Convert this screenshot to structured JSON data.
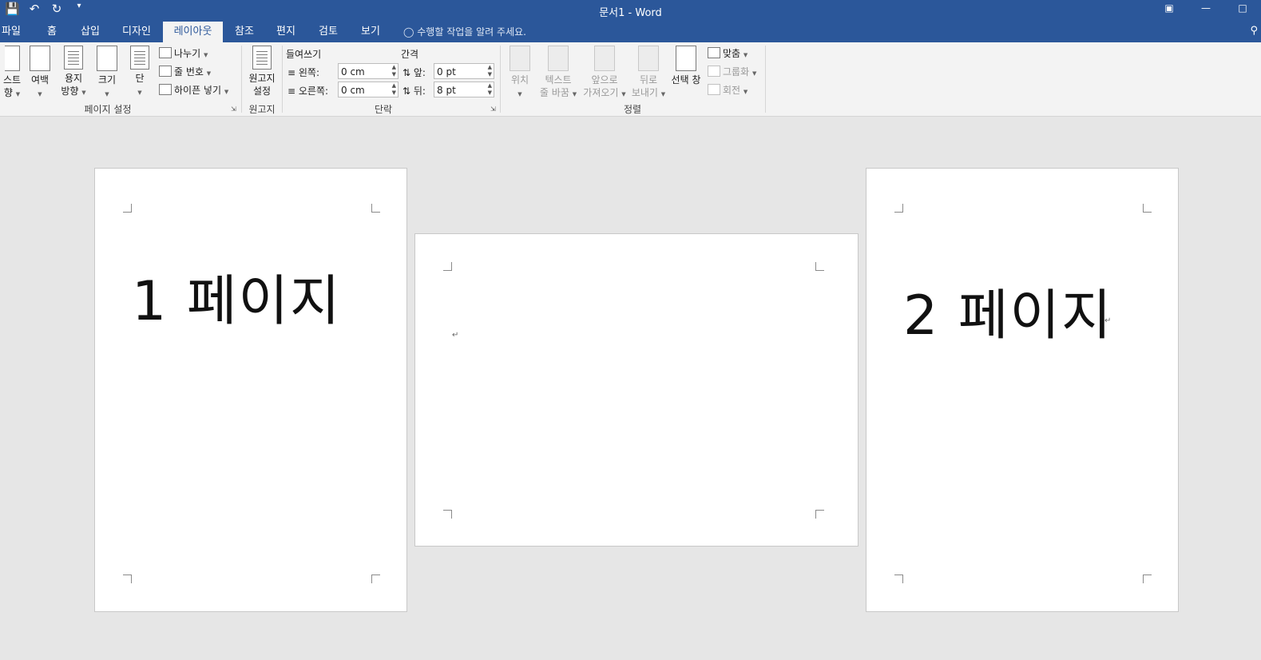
{
  "window": {
    "title": "문서1 - Word"
  },
  "qat": {
    "save_icon": "save-icon",
    "undo_icon": "undo-icon",
    "redo_icon": "redo-icon",
    "customize_icon": "customize-qat-icon"
  },
  "tabs": [
    {
      "label": "파일"
    },
    {
      "label": "홈"
    },
    {
      "label": "삽입"
    },
    {
      "label": "디자인"
    },
    {
      "label": "레이아웃"
    },
    {
      "label": "참조"
    },
    {
      "label": "편지"
    },
    {
      "label": "검토"
    },
    {
      "label": "보기"
    }
  ],
  "tell_me": "수행할 작업을 알려 주세요.",
  "ribbon": {
    "page_setup": {
      "label": "페이지 설정",
      "text_direction_line1": "스트",
      "text_direction_line2": "향",
      "margins": "여백",
      "orientation_line1": "용지",
      "orientation_line2": "방향",
      "size": "크기",
      "columns": "단",
      "breaks": "나누기",
      "line_numbers": "줄 번호",
      "hyphenation": "하이픈 넣기"
    },
    "manuscript": {
      "label": "원고지",
      "button_line1": "원고지",
      "button_line2": "설정"
    },
    "paragraph": {
      "label": "단락",
      "indent_header": "들여쓰기",
      "spacing_header": "간격",
      "left_label": "왼쪽:",
      "right_label": "오른쪽:",
      "before_label": "앞:",
      "after_label": "뒤:",
      "left_value": "0 cm",
      "right_value": "0 cm",
      "before_value": "0 pt",
      "after_value": "8 pt"
    },
    "arrange": {
      "label": "정렬",
      "position": "위치",
      "wrap_line1": "텍스트",
      "wrap_line2": "줄 바꿈",
      "forward_line1": "앞으로",
      "forward_line2": "가져오기",
      "backward_line1": "뒤로",
      "backward_line2": "보내기",
      "selection_pane": "선택 창",
      "align": "맞춤",
      "group": "그룹화",
      "rotate": "회전"
    }
  },
  "document": {
    "page1_text": "1 페이지",
    "page2_text": "2 페이지",
    "paragraph_mark": "↵"
  }
}
